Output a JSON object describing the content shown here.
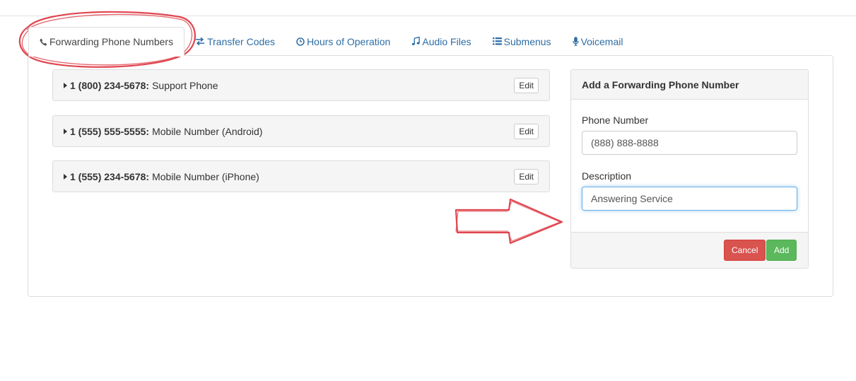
{
  "tabs": [
    {
      "label": "Forwarding Phone Numbers",
      "icon": "phone-icon",
      "active": true
    },
    {
      "label": "Transfer Codes",
      "icon": "exchange-icon"
    },
    {
      "label": "Hours of Operation",
      "icon": "clock-icon"
    },
    {
      "label": "Audio Files",
      "icon": "music-icon"
    },
    {
      "label": "Submenus",
      "icon": "list-icon"
    },
    {
      "label": "Voicemail",
      "icon": "microphone-icon"
    }
  ],
  "numbers": [
    {
      "number": "1 (800) 234-5678:",
      "description": "Support Phone",
      "edit_label": "Edit"
    },
    {
      "number": "1 (555) 555-5555:",
      "description": "Mobile Number (Android)",
      "edit_label": "Edit"
    },
    {
      "number": "1 (555) 234-5678:",
      "description": "Mobile Number (iPhone)",
      "edit_label": "Edit"
    }
  ],
  "add_form": {
    "title": "Add a Forwarding Phone Number",
    "phone_label": "Phone Number",
    "phone_value": "(888) 888-8888",
    "description_label": "Description",
    "description_value": "Answering Service",
    "cancel_label": "Cancel",
    "add_label": "Add"
  },
  "colors": {
    "link": "#2e6da4",
    "cancel": "#d9534f",
    "add": "#5cb85c",
    "annotation": "#e0454f"
  }
}
